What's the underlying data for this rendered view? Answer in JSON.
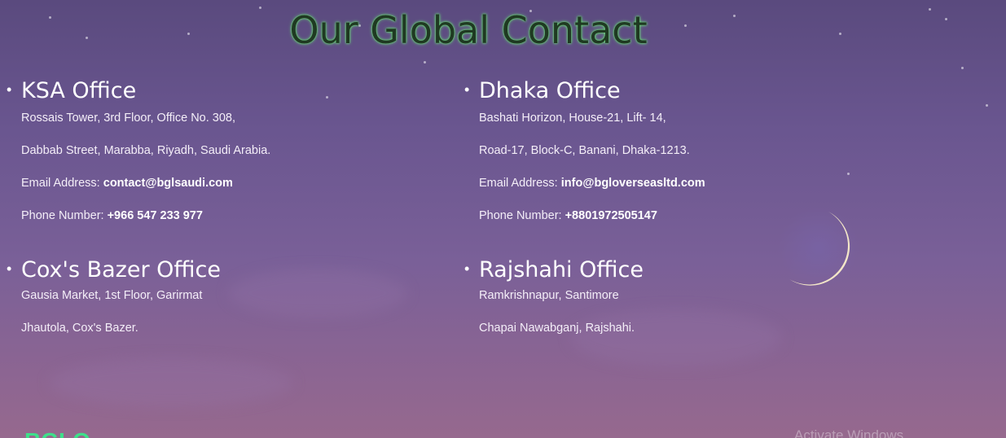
{
  "page_title": "Our Global Contact",
  "offices": [
    {
      "name": "KSA Office",
      "address_line1": "Rossais Tower, 3rd Floor, Office No. 308,",
      "address_line2": "Dabbab Street, Marabba, Riyadh, Saudi Arabia.",
      "email_label": "Email Address:",
      "email": "contact@bglsaudi.com",
      "phone_label": "Phone Number:",
      "phone": "+966 547 233 977"
    },
    {
      "name": "Dhaka Office",
      "address_line1": "Bashati Horizon, House-21, Lift- 14,",
      "address_line2": "Road-17, Block-C, Banani, Dhaka-1213.",
      "email_label": "Email Address:",
      "email": "info@bgloverseasltd.com",
      "phone_label": "Phone Number:",
      "phone": "+8801972505147"
    },
    {
      "name": "Cox's Bazer Office",
      "address_line1": "Gausia Market, 1st Floor, Garirmat",
      "address_line2": "Jhautola, Cox's Bazer."
    },
    {
      "name": "Rajshahi Office",
      "address_line1": "Ramkrishnapur, Santimore",
      "address_line2": "Chapai Nawabganj, Rajshahi."
    }
  ],
  "footer": {
    "logo_text": "BGLO"
  },
  "watermark": "Activate Windows",
  "icons": {
    "background_moon": "crescent-moon-icon"
  }
}
